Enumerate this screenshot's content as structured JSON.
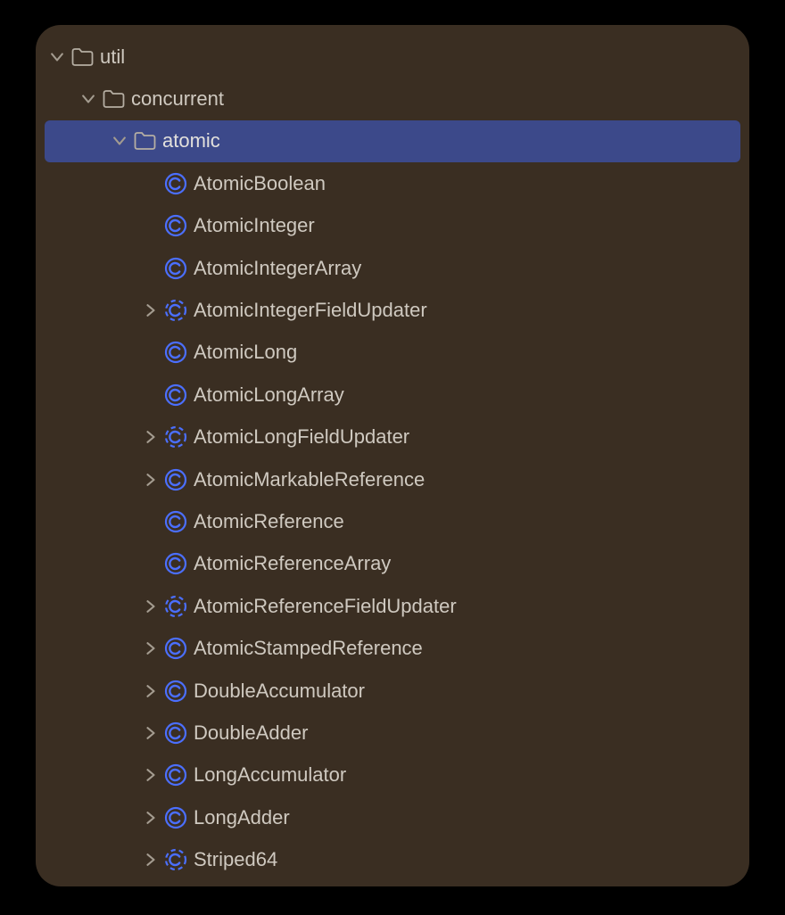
{
  "colors": {
    "bg": "#3a2e22",
    "fg": "#cfc9c0",
    "selectedBg": "#3c498a",
    "folderStroke": "#b5aea3",
    "classStroke": "#4b6fff",
    "classFill": "#4b6fff",
    "arrow": "#a49c90"
  },
  "tree": [
    {
      "depth": 0,
      "arrow": "down",
      "icon": "folder",
      "label": "util",
      "selected": false
    },
    {
      "depth": 1,
      "arrow": "down",
      "icon": "folder",
      "label": "concurrent",
      "selected": false
    },
    {
      "depth": 2,
      "arrow": "down",
      "icon": "folder",
      "label": "atomic",
      "selected": true
    },
    {
      "depth": 3,
      "arrow": "none",
      "icon": "class",
      "label": "AtomicBoolean",
      "selected": false
    },
    {
      "depth": 3,
      "arrow": "none",
      "icon": "class",
      "label": "AtomicInteger",
      "selected": false
    },
    {
      "depth": 3,
      "arrow": "none",
      "icon": "class",
      "label": "AtomicIntegerArray",
      "selected": false
    },
    {
      "depth": 3,
      "arrow": "right",
      "icon": "abstract",
      "label": "AtomicIntegerFieldUpdater",
      "selected": false
    },
    {
      "depth": 3,
      "arrow": "none",
      "icon": "class",
      "label": "AtomicLong",
      "selected": false
    },
    {
      "depth": 3,
      "arrow": "none",
      "icon": "class",
      "label": "AtomicLongArray",
      "selected": false
    },
    {
      "depth": 3,
      "arrow": "right",
      "icon": "abstract",
      "label": "AtomicLongFieldUpdater",
      "selected": false
    },
    {
      "depth": 3,
      "arrow": "right",
      "icon": "class",
      "label": "AtomicMarkableReference",
      "selected": false
    },
    {
      "depth": 3,
      "arrow": "none",
      "icon": "class",
      "label": "AtomicReference",
      "selected": false
    },
    {
      "depth": 3,
      "arrow": "none",
      "icon": "class",
      "label": "AtomicReferenceArray",
      "selected": false
    },
    {
      "depth": 3,
      "arrow": "right",
      "icon": "abstract",
      "label": "AtomicReferenceFieldUpdater",
      "selected": false
    },
    {
      "depth": 3,
      "arrow": "right",
      "icon": "class",
      "label": "AtomicStampedReference",
      "selected": false
    },
    {
      "depth": 3,
      "arrow": "right",
      "icon": "class",
      "label": "DoubleAccumulator",
      "selected": false
    },
    {
      "depth": 3,
      "arrow": "right",
      "icon": "class",
      "label": "DoubleAdder",
      "selected": false
    },
    {
      "depth": 3,
      "arrow": "right",
      "icon": "class",
      "label": "LongAccumulator",
      "selected": false
    },
    {
      "depth": 3,
      "arrow": "right",
      "icon": "class",
      "label": "LongAdder",
      "selected": false
    },
    {
      "depth": 3,
      "arrow": "right",
      "icon": "abstract",
      "label": "Striped64",
      "selected": false
    }
  ]
}
